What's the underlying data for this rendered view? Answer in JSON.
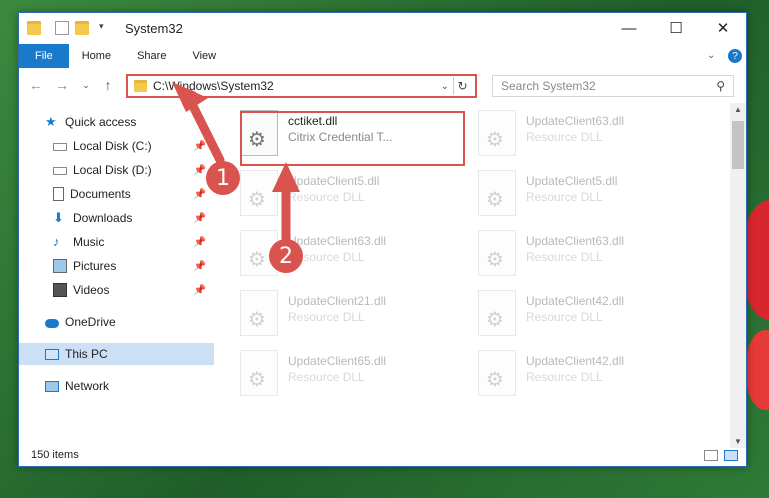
{
  "window": {
    "title": "System32",
    "controls": {
      "minimize": "—",
      "maximize": "☐",
      "close": "✕"
    }
  },
  "ribbon": {
    "tabs": [
      "File",
      "Home",
      "Share",
      "View"
    ]
  },
  "address": {
    "path": "C:\\Windows\\System32",
    "search_placeholder": "Search System32"
  },
  "sidebar": {
    "items": [
      {
        "label": "Quick access",
        "icon": "star-icon"
      },
      {
        "label": "Local Disk (C:)",
        "icon": "drive-icon"
      },
      {
        "label": "Local Disk (D:)",
        "icon": "drive-icon"
      },
      {
        "label": "Documents",
        "icon": "documents-icon"
      },
      {
        "label": "Downloads",
        "icon": "downloads-icon"
      },
      {
        "label": "Music",
        "icon": "music-icon"
      },
      {
        "label": "Pictures",
        "icon": "pictures-icon"
      },
      {
        "label": "Videos",
        "icon": "videos-icon"
      },
      {
        "label": "OneDrive",
        "icon": "cloud-icon"
      },
      {
        "label": "This PC",
        "icon": "computer-icon"
      },
      {
        "label": "Network",
        "icon": "network-icon"
      }
    ]
  },
  "files": [
    {
      "name": "cctiket.dll",
      "type": "Citrix Credential T..."
    },
    {
      "name": "UpdateClient63.dll",
      "type": "Resource DLL"
    },
    {
      "name": "UpdateClient5.dll",
      "type": "Resource DLL"
    },
    {
      "name": "UpdateClient5.dll",
      "type": "Resource DLL"
    },
    {
      "name": "UpdateClient63.dll",
      "type": "Resource DLL"
    },
    {
      "name": "UpdateClient63.dll",
      "type": "Resource DLL"
    },
    {
      "name": "UpdateClient21.dll",
      "type": "Resource DLL"
    },
    {
      "name": "UpdateClient42.dll",
      "type": "Resource DLL"
    },
    {
      "name": "UpdateClient65.dll",
      "type": "Resource DLL"
    },
    {
      "name": "UpdateClient42.dll",
      "type": "Resource DLL"
    }
  ],
  "status": {
    "item_count": "150 items"
  },
  "annotations": {
    "step1": "1",
    "step2": "2"
  },
  "colors": {
    "accent": "#1979ca",
    "highlight": "#d9534f",
    "selected": "#cce0f5"
  }
}
